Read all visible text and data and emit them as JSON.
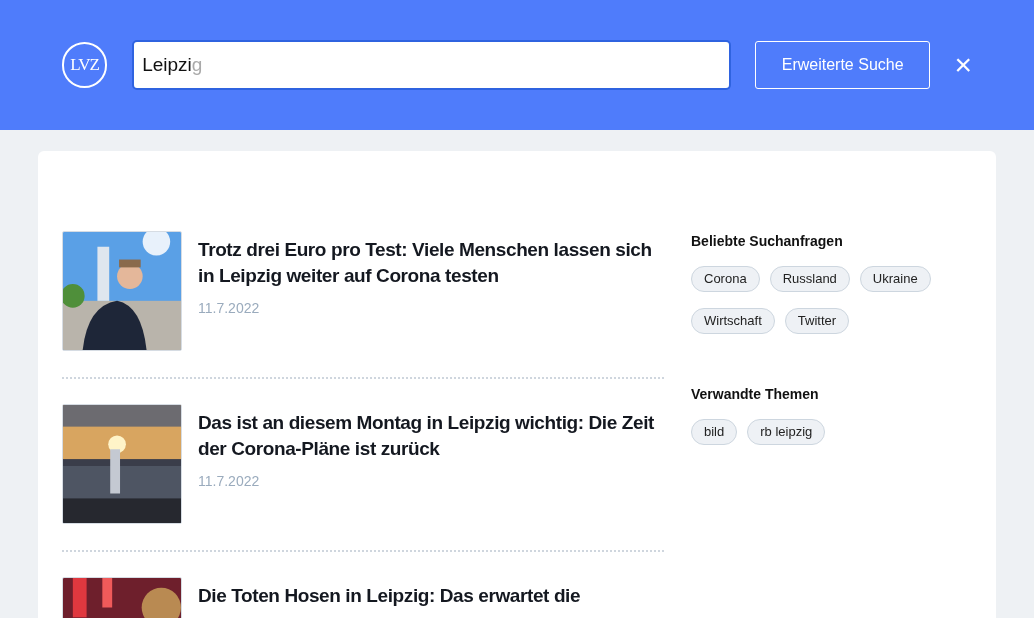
{
  "header": {
    "logo": "LVZ",
    "search": {
      "value": "Leipzi",
      "suggestion": "g"
    },
    "advanced_button": "Erweiterte Suche",
    "close": "×"
  },
  "articles": [
    {
      "title": "Trotz drei Euro pro Test: Viele Menschen lassen sich in Leipzig weiter auf Corona testen",
      "date": "11.7.2022"
    },
    {
      "title": "Das ist an diesem Montag in Leipzig wichtig: Die Zeit der Corona-Pläne ist zurück",
      "date": "11.7.2022"
    },
    {
      "title": "Die Toten Hosen in Leipzig: Das erwartet die"
    }
  ],
  "sidebar": [
    {
      "heading": "Beliebte Suchanfragen",
      "tags": [
        "Corona",
        "Russland",
        "Ukraine",
        "Wirtschaft",
        "Twitter"
      ]
    },
    {
      "heading": "Verwandte Themen",
      "tags": [
        "bild",
        "rb leipzig"
      ]
    }
  ]
}
